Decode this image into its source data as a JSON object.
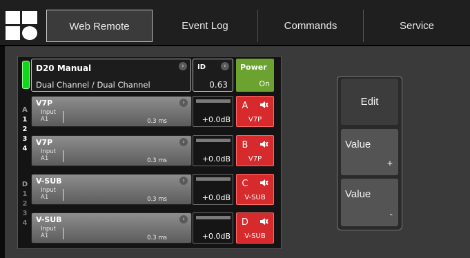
{
  "nav": {
    "tabs": [
      "Web Remote",
      "Event Log",
      "Commands",
      "Service"
    ],
    "active": "Web Remote"
  },
  "device": {
    "name": "D20 Manual",
    "mode": "Dual Channel / Dual Channel",
    "id_label": "ID",
    "id_value": "0.63",
    "power_label": "Power",
    "power_value": "On",
    "status_color": "#12d61a"
  },
  "side_letters": [
    "A",
    "1",
    "2",
    "3",
    "4",
    "D",
    "1",
    "2",
    "3",
    "4"
  ],
  "channels": [
    {
      "name": "V7P",
      "input_label": "Input",
      "input": "A1",
      "delay": "0.3 ms",
      "gain": "+0.0dB",
      "mute_letter": "A",
      "mute_name": "V7P"
    },
    {
      "name": "V7P",
      "input_label": "Input",
      "input": "A1",
      "delay": "0.3 ms",
      "gain": "+0.0dB",
      "mute_letter": "B",
      "mute_name": "V7P"
    },
    {
      "name": "V-SUB",
      "input_label": "Input",
      "input": "A1",
      "delay": "0.3 ms",
      "gain": "+0.0dB",
      "mute_letter": "C",
      "mute_name": "V-SUB"
    },
    {
      "name": "V-SUB",
      "input_label": "Input",
      "input": "A1",
      "delay": "0.3 ms",
      "gain": "+0.0dB",
      "mute_letter": "D",
      "mute_name": "V-SUB"
    }
  ],
  "buttons": {
    "edit": "Edit",
    "value_plus_label": "Value",
    "value_plus_sign": "+",
    "value_minus_label": "Value",
    "value_minus_sign": "-"
  },
  "icons": {
    "mute": "speaker-muted-icon",
    "chevron": "chevron-right-icon",
    "logo": "brand-logo-icon"
  },
  "colors": {
    "mute_red": "#d62a2c",
    "power_green": "#6ca22f"
  }
}
